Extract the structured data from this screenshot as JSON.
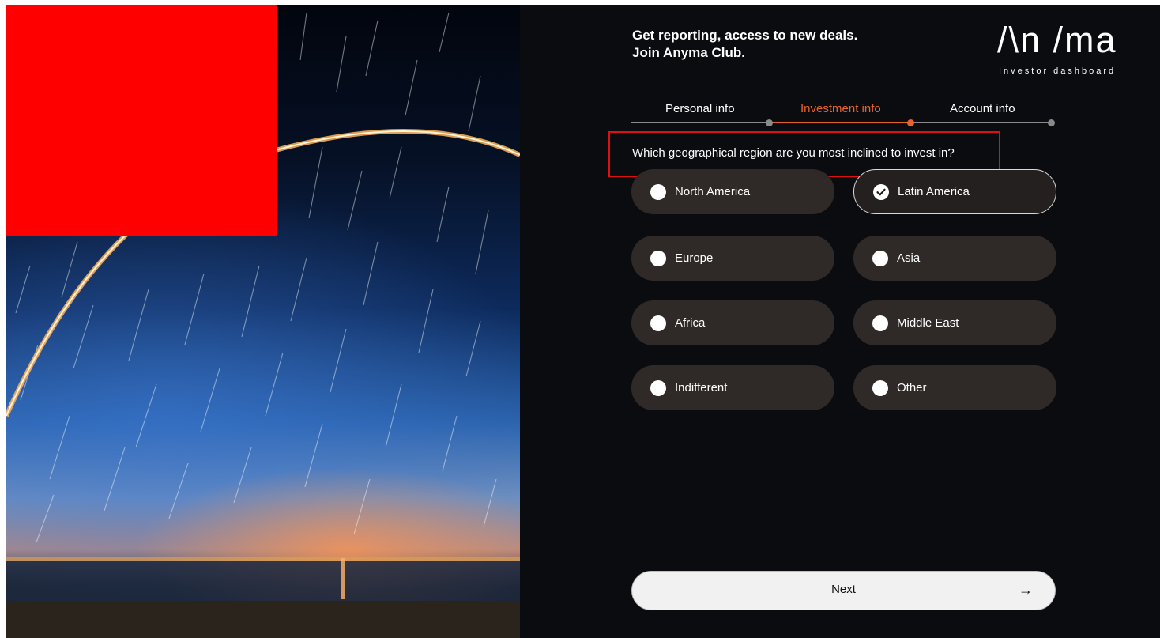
{
  "header": {
    "headline_line1": "Get reporting, access to new deals.",
    "headline_line2": "Join Anyma Club.",
    "logo_text": "/\\n /ma",
    "logo_subtitle": "Investor dashboard"
  },
  "steps": [
    {
      "label": "Personal info",
      "state": "done"
    },
    {
      "label": "Investment info",
      "state": "active"
    },
    {
      "label": "Account info",
      "state": "pending"
    }
  ],
  "question": "Which geographical region are you most inclined to invest in?",
  "options": [
    {
      "label": "North America",
      "selected": false
    },
    {
      "label": "Latin America",
      "selected": true
    },
    {
      "label": "Europe",
      "selected": false
    },
    {
      "label": "Asia",
      "selected": false
    },
    {
      "label": "Africa",
      "selected": false
    },
    {
      "label": "Middle East",
      "selected": false
    },
    {
      "label": "Indifferent",
      "selected": false
    },
    {
      "label": "Other",
      "selected": false
    }
  ],
  "next_button": {
    "label": "Next",
    "arrow": "→"
  },
  "colors": {
    "accent": "#e8622c",
    "panel_bg": "#0b0c10",
    "option_bg": "#2f2927",
    "highlight_box": "#e01010",
    "redaction_box": "#ff0000"
  }
}
